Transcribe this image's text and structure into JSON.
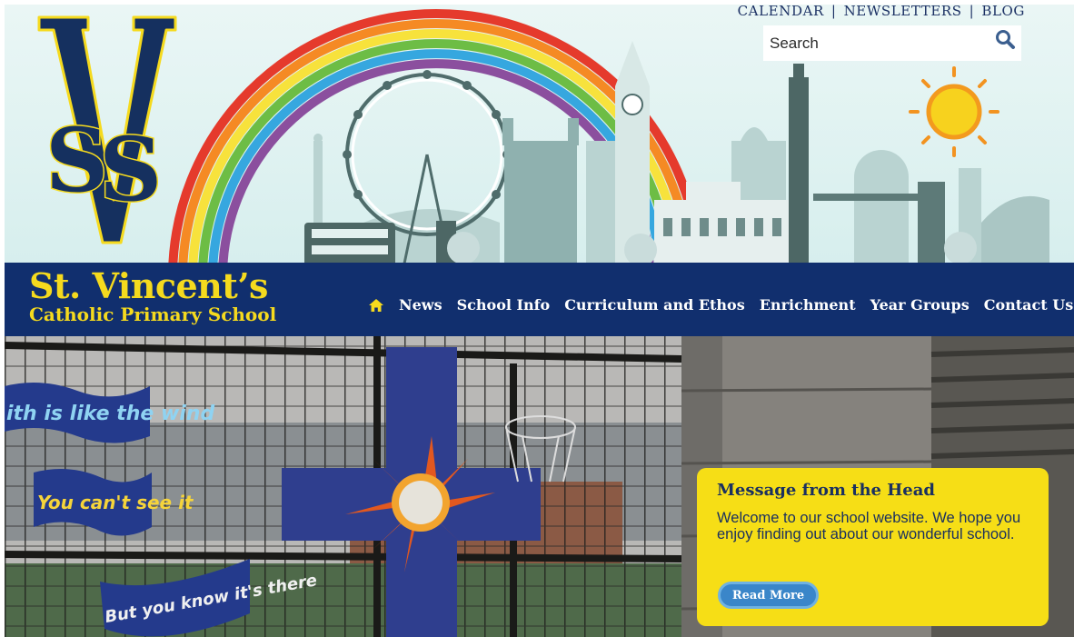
{
  "top_links": {
    "calendar": "CALENDAR",
    "newsletters": "NEWSLETTERS",
    "blog": "BLOG",
    "separator": "|"
  },
  "search": {
    "placeholder": "Search",
    "icon": "search-icon"
  },
  "school": {
    "name_line1": "St. Vincent’s",
    "name_line2": "Catholic Primary School",
    "crest_letters": "SV"
  },
  "nav": {
    "home_icon": "home-icon",
    "items": [
      "News",
      "School Info",
      "Curriculum and Ethos",
      "Enrichment",
      "Year Groups",
      "Contact Us"
    ]
  },
  "hero": {
    "banner_texts": [
      "ith is like the wind",
      "You can't see it",
      "But you know it's there"
    ]
  },
  "message": {
    "title": "Message from the Head",
    "body": "Welcome to our school website. We hope you enjoy finding out about our wonderful school.",
    "button": "Read More"
  },
  "colors": {
    "navy": "#112f6e",
    "yellow": "#f5da1e",
    "button_blue": "#3a86c9"
  }
}
